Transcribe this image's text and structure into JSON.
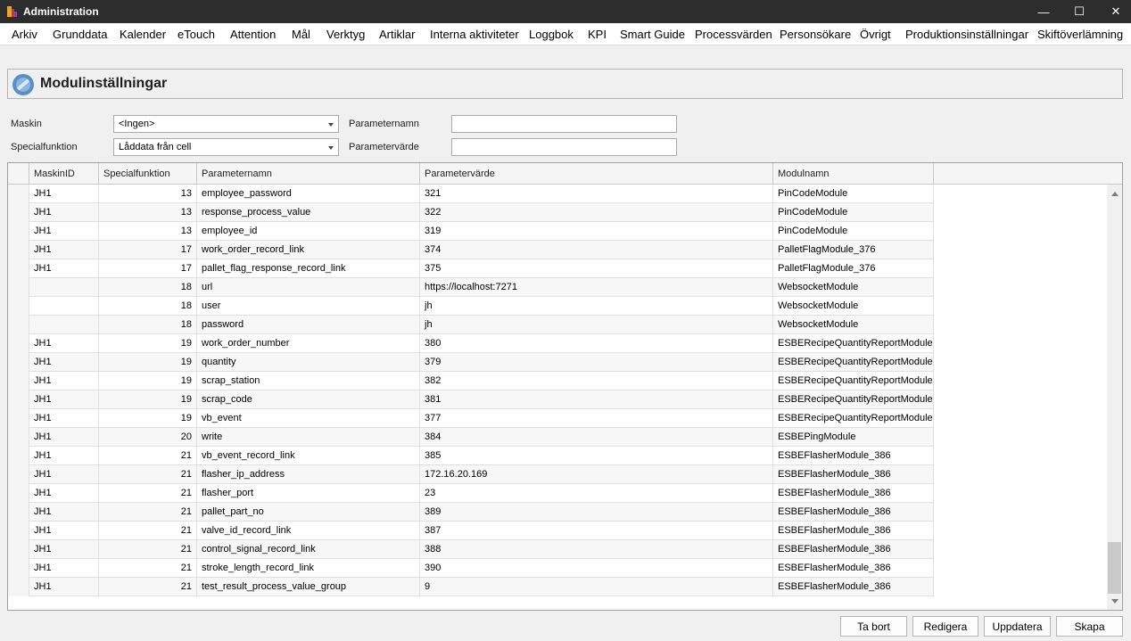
{
  "window": {
    "title": "Administration",
    "minimize_glyph": "—",
    "maximize_glyph": "☐",
    "close_glyph": "✕"
  },
  "menu": [
    "Arkiv",
    "Grunddata",
    "Kalender",
    "eTouch",
    "Attention",
    "Mål",
    "Verktyg",
    "Artiklar",
    "Interna aktiviteter",
    "Loggbok",
    "KPI",
    "Smart Guide",
    "Processvärden",
    "Personsökare",
    "Övrigt",
    "Produktionsinställningar",
    "Skiftöverlämning"
  ],
  "page": {
    "title": "Modulinställningar",
    "icon": "settings-tool-icon"
  },
  "filters": {
    "maskin_label": "Maskin",
    "maskin_value": "<Ingen>",
    "specialfunktion_label": "Specialfunktion",
    "specialfunktion_value": "Låddata från cell",
    "parameternamn_label": "Parameternamn",
    "parameternamn_value": "",
    "parametervarde_label": "Parametervärde",
    "parametervarde_value": ""
  },
  "grid": {
    "columns": [
      "MaskinID",
      "Specialfunktion",
      "Parameternamn",
      "Parametervärde",
      "Modulnamn"
    ],
    "rows": [
      [
        "JH1",
        "13",
        "employee_password",
        "321",
        "PinCodeModule"
      ],
      [
        "JH1",
        "13",
        "response_process_value",
        "322",
        "PinCodeModule"
      ],
      [
        "JH1",
        "13",
        "employee_id",
        "319",
        "PinCodeModule"
      ],
      [
        "JH1",
        "17",
        "work_order_record_link",
        "374",
        "PalletFlagModule_376"
      ],
      [
        "JH1",
        "17",
        "pallet_flag_response_record_link",
        "375",
        "PalletFlagModule_376"
      ],
      [
        "",
        "18",
        "url",
        "https://localhost:7271",
        "WebsocketModule"
      ],
      [
        "",
        "18",
        "user",
        "jh",
        "WebsocketModule"
      ],
      [
        "",
        "18",
        "password",
        "jh",
        "WebsocketModule"
      ],
      [
        "JH1",
        "19",
        "work_order_number",
        "380",
        "ESBERecipeQuantityReportModule"
      ],
      [
        "JH1",
        "19",
        "quantity",
        "379",
        "ESBERecipeQuantityReportModule"
      ],
      [
        "JH1",
        "19",
        "scrap_station",
        "382",
        "ESBERecipeQuantityReportModule"
      ],
      [
        "JH1",
        "19",
        "scrap_code",
        "381",
        "ESBERecipeQuantityReportModule"
      ],
      [
        "JH1",
        "19",
        "vb_event",
        "377",
        "ESBERecipeQuantityReportModule"
      ],
      [
        "JH1",
        "20",
        "write",
        "384",
        "ESBEPingModule"
      ],
      [
        "JH1",
        "21",
        "vb_event_record_link",
        "385",
        "ESBEFlasherModule_386"
      ],
      [
        "JH1",
        "21",
        "flasher_ip_address",
        "172.16.20.169",
        "ESBEFlasherModule_386"
      ],
      [
        "JH1",
        "21",
        "flasher_port",
        "23",
        "ESBEFlasherModule_386"
      ],
      [
        "JH1",
        "21",
        "pallet_part_no",
        "389",
        "ESBEFlasherModule_386"
      ],
      [
        "JH1",
        "21",
        "valve_id_record_link",
        "387",
        "ESBEFlasherModule_386"
      ],
      [
        "JH1",
        "21",
        "control_signal_record_link",
        "388",
        "ESBEFlasherModule_386"
      ],
      [
        "JH1",
        "21",
        "stroke_length_record_link",
        "390",
        "ESBEFlasherModule_386"
      ],
      [
        "JH1",
        "21",
        "test_result_process_value_group",
        "9",
        "ESBEFlasherModule_386"
      ]
    ]
  },
  "buttons": {
    "ta_bort": "Ta bort",
    "redigera": "Redigera",
    "uppdatera": "Uppdatera",
    "skapa": "Skapa"
  }
}
